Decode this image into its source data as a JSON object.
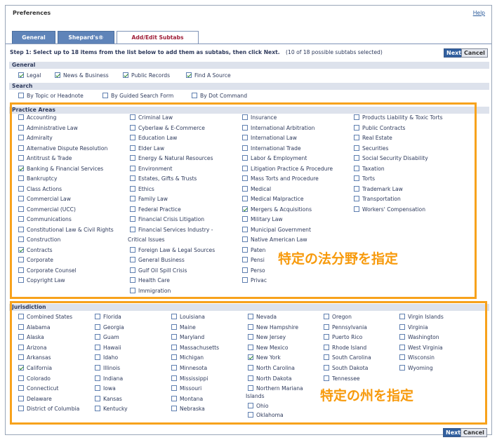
{
  "header": {
    "title": "Preferences",
    "help": "Help"
  },
  "tabs": [
    "General",
    "Shepard's®",
    "Add/Edit Subtabs"
  ],
  "step": {
    "label": "Step 1: Select up to 18 items from the list below to add them as subtabs, then click Next.",
    "count": "(10 of 18 possible subtabs selected)"
  },
  "buttons": {
    "next": "Next",
    "cancel": "Cancel"
  },
  "general": {
    "title": "General",
    "items": [
      {
        "label": "Legal",
        "checked": true
      },
      {
        "label": "News & Business",
        "checked": true
      },
      {
        "label": "Public Records",
        "checked": true
      },
      {
        "label": "Find A Source",
        "checked": true
      }
    ]
  },
  "search": {
    "title": "Search",
    "items": [
      {
        "label": "By Topic or Headnote",
        "checked": false
      },
      {
        "label": "By Guided Search Form",
        "checked": false
      },
      {
        "label": "By Dot Command",
        "checked": false
      }
    ]
  },
  "practice": {
    "title": "Practice Areas",
    "columns": [
      [
        {
          "label": "Accounting",
          "checked": false
        },
        {
          "label": "Administrative Law",
          "checked": false
        },
        {
          "label": "Admiralty",
          "checked": false
        },
        {
          "label": "Alternative Dispute Resolution",
          "checked": false
        },
        {
          "label": "Antitrust & Trade",
          "checked": false
        },
        {
          "label": "Banking & Financial Services",
          "checked": true
        },
        {
          "label": "Bankruptcy",
          "checked": false
        },
        {
          "label": "Class Actions",
          "checked": false
        },
        {
          "label": "Commercial Law",
          "checked": false
        },
        {
          "label": "Commercial (UCC)",
          "checked": false
        },
        {
          "label": "Communications",
          "checked": false
        },
        {
          "label": "Constitutional Law & Civil Rights",
          "checked": false
        },
        {
          "label": "Construction",
          "checked": false
        },
        {
          "label": "Contracts",
          "checked": true
        },
        {
          "label": "Corporate",
          "checked": false
        },
        {
          "label": "Corporate Counsel",
          "checked": false
        },
        {
          "label": "Copyright Law",
          "checked": false
        }
      ],
      [
        {
          "label": "Criminal Law",
          "checked": false
        },
        {
          "label": "Cyberlaw & E-Commerce",
          "checked": false
        },
        {
          "label": "Education Law",
          "checked": false
        },
        {
          "label": "Elder Law",
          "checked": false
        },
        {
          "label": "Energy & Natural Resources",
          "checked": false
        },
        {
          "label": "Environment",
          "checked": false
        },
        {
          "label": "Estates, Gifts & Trusts",
          "checked": false
        },
        {
          "label": "Ethics",
          "checked": false
        },
        {
          "label": "Family Law",
          "checked": false
        },
        {
          "label": "Federal Practice",
          "checked": false
        },
        {
          "label": "Financial Crisis Litigation",
          "checked": false
        },
        {
          "label": "Financial Services Industry -",
          "checked": false
        },
        {
          "label": "Critical Issues",
          "checked": false,
          "continuation": true
        },
        {
          "label": "Foreign Law & Legal Sources",
          "checked": false
        },
        {
          "label": "General Business",
          "checked": false
        },
        {
          "label": "Gulf Oil Spill Crisis",
          "checked": false
        },
        {
          "label": "Health Care",
          "checked": false
        },
        {
          "label": "Immigration",
          "checked": false
        }
      ],
      [
        {
          "label": "Insurance",
          "checked": false
        },
        {
          "label": "International Arbitration",
          "checked": false
        },
        {
          "label": "International Law",
          "checked": false
        },
        {
          "label": "International Trade",
          "checked": false
        },
        {
          "label": "Labor & Employment",
          "checked": false
        },
        {
          "label": "Litigation Practice & Procedure",
          "checked": false
        },
        {
          "label": "Mass Torts and Procedure",
          "checked": false
        },
        {
          "label": "Medical",
          "checked": false
        },
        {
          "label": "Medical Malpractice",
          "checked": false
        },
        {
          "label": "Mergers & Acquisitions",
          "checked": true
        },
        {
          "label": "Military Law",
          "checked": false
        },
        {
          "label": "Municipal Government",
          "checked": false
        },
        {
          "label": "Native American Law",
          "checked": false
        },
        {
          "label": "Paten",
          "checked": false
        },
        {
          "label": "Pensi",
          "checked": false
        },
        {
          "label": "Perso",
          "checked": false
        },
        {
          "label": "Privac",
          "checked": false
        }
      ],
      [
        {
          "label": "Products Liability & Toxic Torts",
          "checked": false
        },
        {
          "label": "Public Contracts",
          "checked": false
        },
        {
          "label": "Real Estate",
          "checked": false
        },
        {
          "label": "Securities",
          "checked": false
        },
        {
          "label": "Social Security Disability",
          "checked": false
        },
        {
          "label": "Taxation",
          "checked": false
        },
        {
          "label": "Torts",
          "checked": false
        },
        {
          "label": "Trademark Law",
          "checked": false
        },
        {
          "label": "Transportation",
          "checked": false
        },
        {
          "label": "Workers' Compensation",
          "checked": false
        }
      ]
    ]
  },
  "jurisdiction": {
    "title": "Jurisdiction",
    "columns": [
      [
        {
          "label": "Combined States",
          "checked": false
        },
        {
          "label": "Alabama",
          "checked": false
        },
        {
          "label": "Alaska",
          "checked": false
        },
        {
          "label": "Arizona",
          "checked": false
        },
        {
          "label": "Arkansas",
          "checked": false
        },
        {
          "label": "California",
          "checked": true
        },
        {
          "label": "Colorado",
          "checked": false
        },
        {
          "label": "Connecticut",
          "checked": false
        },
        {
          "label": "Delaware",
          "checked": false
        },
        {
          "label": "District of Columbia",
          "checked": false
        }
      ],
      [
        {
          "label": "Florida",
          "checked": false
        },
        {
          "label": "Georgia",
          "checked": false
        },
        {
          "label": "Guam",
          "checked": false
        },
        {
          "label": "Hawaii",
          "checked": false
        },
        {
          "label": "Idaho",
          "checked": false
        },
        {
          "label": "Illinois",
          "checked": false
        },
        {
          "label": "Indiana",
          "checked": false
        },
        {
          "label": "Iowa",
          "checked": false
        },
        {
          "label": "Kansas",
          "checked": false
        },
        {
          "label": "Kentucky",
          "checked": false
        }
      ],
      [
        {
          "label": "Louisiana",
          "checked": false
        },
        {
          "label": "Maine",
          "checked": false
        },
        {
          "label": "Maryland",
          "checked": false
        },
        {
          "label": "Massachusetts",
          "checked": false
        },
        {
          "label": "Michigan",
          "checked": false
        },
        {
          "label": "Minnesota",
          "checked": false
        },
        {
          "label": "Mississippi",
          "checked": false
        },
        {
          "label": "Missouri",
          "checked": false
        },
        {
          "label": "Montana",
          "checked": false
        },
        {
          "label": "Nebraska",
          "checked": false
        }
      ],
      [
        {
          "label": "Nevada",
          "checked": false
        },
        {
          "label": "New Hampshire",
          "checked": false
        },
        {
          "label": "New Jersey",
          "checked": false
        },
        {
          "label": "New Mexico",
          "checked": false
        },
        {
          "label": "New York",
          "checked": true
        },
        {
          "label": "North Carolina",
          "checked": false
        },
        {
          "label": "North Dakota",
          "checked": false
        },
        {
          "label": "Northern Mariana",
          "checked": false
        },
        {
          "label": "Islands",
          "checked": false,
          "continuation": true
        },
        {
          "label": "Ohio",
          "checked": false
        },
        {
          "label": "Oklahoma",
          "checked": false
        }
      ],
      [
        {
          "label": "Oregon",
          "checked": false
        },
        {
          "label": "Pennsylvania",
          "checked": false
        },
        {
          "label": "Puerto Rico",
          "checked": false
        },
        {
          "label": "Rhode Island",
          "checked": false
        },
        {
          "label": "South Carolina",
          "checked": false
        },
        {
          "label": "South Dakota",
          "checked": false
        },
        {
          "label": "Tennessee",
          "checked": false
        }
      ],
      [
        {
          "label": "Virgin Islands",
          "checked": false
        },
        {
          "label": "Virginia",
          "checked": false
        },
        {
          "label": "Washington",
          "checked": false
        },
        {
          "label": "West Virginia",
          "checked": false
        },
        {
          "label": "Wisconsin",
          "checked": false
        },
        {
          "label": "Wyoming",
          "checked": false
        }
      ]
    ]
  },
  "annotations": {
    "practice": "特定の法分野を指定",
    "jurisdiction": "特定の州を指定"
  },
  "colors": {
    "highlight": "#f7a21c",
    "accent": "#305f9f",
    "tab_active_text": "#a0203a"
  }
}
